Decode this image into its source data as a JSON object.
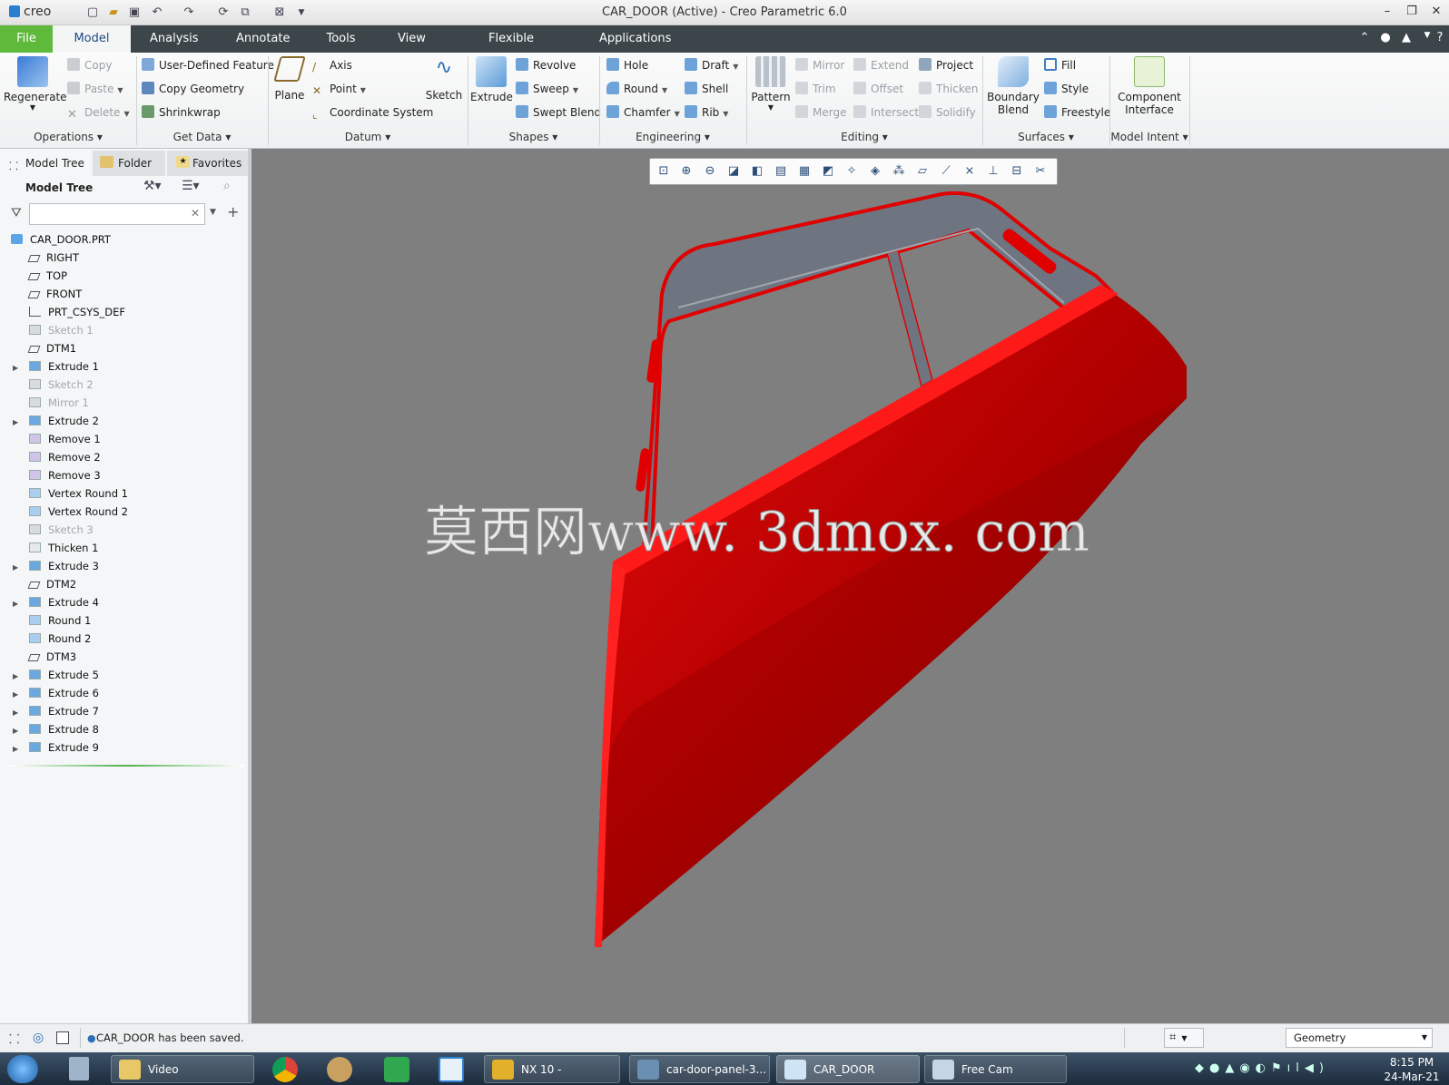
{
  "app": {
    "logo": "creo",
    "window_title": "CAR_DOOR (Active) - Creo Parametric 6.0"
  },
  "tabs": [
    "File",
    "Model",
    "Analysis",
    "Annotate",
    "Tools",
    "View",
    "Flexible Modeling",
    "Applications"
  ],
  "ribbon": {
    "operations": {
      "label": "Operations",
      "regenerate": "Regenerate",
      "copy": "Copy",
      "paste": "Paste",
      "delete": "Delete"
    },
    "get_data": {
      "label": "Get Data",
      "udf": "User-Defined Feature",
      "copy_geometry": "Copy Geometry",
      "shrinkwrap": "Shrinkwrap"
    },
    "datum": {
      "label": "Datum",
      "plane": "Plane",
      "axis": "Axis",
      "point": "Point",
      "csys": "Coordinate System",
      "sketch": "Sketch"
    },
    "shapes": {
      "label": "Shapes",
      "extrude": "Extrude",
      "revolve": "Revolve",
      "sweep": "Sweep",
      "swept_blend": "Swept Blend"
    },
    "engineering": {
      "label": "Engineering",
      "hole": "Hole",
      "round": "Round",
      "chamfer": "Chamfer",
      "draft": "Draft",
      "shell": "Shell",
      "rib": "Rib"
    },
    "editing": {
      "label": "Editing",
      "pattern": "Pattern",
      "mirror": "Mirror",
      "trim": "Trim",
      "merge": "Merge",
      "extend": "Extend",
      "offset": "Offset",
      "intersect": "Intersect",
      "project": "Project",
      "thicken": "Thicken",
      "solidify": "Solidify"
    },
    "surfaces": {
      "label": "Surfaces",
      "boundary_blend_1": "Boundary",
      "boundary_blend_2": "Blend",
      "fill": "Fill",
      "style": "Style",
      "freestyle": "Freestyle"
    },
    "model_intent": {
      "label": "Model Intent",
      "ci_1": "Component",
      "ci_2": "Interface"
    }
  },
  "panel": {
    "tabs": [
      "Model Tree",
      "Folder Br",
      "Favorites"
    ],
    "tree_header": "Model Tree",
    "filter_placeholder": "",
    "root": "CAR_DOOR.PRT",
    "items": [
      {
        "label": "RIGHT",
        "icon": "datum-plane-icon",
        "dim": false,
        "expand": false
      },
      {
        "label": "TOP",
        "icon": "datum-plane-icon",
        "dim": false,
        "expand": false
      },
      {
        "label": "FRONT",
        "icon": "datum-plane-icon",
        "dim": false,
        "expand": false
      },
      {
        "label": "PRT_CSYS_DEF",
        "icon": "csys-icon",
        "dim": false,
        "expand": false
      },
      {
        "label": "Sketch 1",
        "icon": "sketch-icon",
        "dim": true,
        "expand": false
      },
      {
        "label": "DTM1",
        "icon": "datum-plane-icon",
        "dim": false,
        "expand": false
      },
      {
        "label": "Extrude 1",
        "icon": "extrude-icon",
        "dim": false,
        "expand": true
      },
      {
        "label": "Sketch 2",
        "icon": "sketch-icon",
        "dim": true,
        "expand": false
      },
      {
        "label": "Mirror 1",
        "icon": "mirror-icon",
        "dim": true,
        "expand": false
      },
      {
        "label": "Extrude 2",
        "icon": "extrude-icon",
        "dim": false,
        "expand": true
      },
      {
        "label": "Remove 1",
        "icon": "remove-icon",
        "dim": false,
        "expand": false
      },
      {
        "label": "Remove 2",
        "icon": "remove-icon",
        "dim": false,
        "expand": false
      },
      {
        "label": "Remove 3",
        "icon": "remove-icon",
        "dim": false,
        "expand": false
      },
      {
        "label": "Vertex Round 1",
        "icon": "vertex-round-icon",
        "dim": false,
        "expand": false
      },
      {
        "label": "Vertex Round 2",
        "icon": "vertex-round-icon",
        "dim": false,
        "expand": false
      },
      {
        "label": "Sketch 3",
        "icon": "sketch-icon",
        "dim": true,
        "expand": false
      },
      {
        "label": "Thicken 1",
        "icon": "thicken-icon",
        "dim": false,
        "expand": false
      },
      {
        "label": "Extrude 3",
        "icon": "extrude-icon",
        "dim": false,
        "expand": true
      },
      {
        "label": "DTM2",
        "icon": "datum-plane-icon",
        "dim": false,
        "expand": false
      },
      {
        "label": "Extrude 4",
        "icon": "extrude-icon",
        "dim": false,
        "expand": true
      },
      {
        "label": "Round 1",
        "icon": "round-icon",
        "dim": false,
        "expand": false
      },
      {
        "label": "Round 2",
        "icon": "round-icon",
        "dim": false,
        "expand": false
      },
      {
        "label": "DTM3",
        "icon": "datum-plane-icon",
        "dim": false,
        "expand": false
      },
      {
        "label": "Extrude 5",
        "icon": "extrude-icon",
        "dim": false,
        "expand": true
      },
      {
        "label": "Extrude 6",
        "icon": "extrude-icon",
        "dim": false,
        "expand": true
      },
      {
        "label": "Extrude 7",
        "icon": "extrude-icon",
        "dim": false,
        "expand": true
      },
      {
        "label": "Extrude 8",
        "icon": "extrude-icon",
        "dim": false,
        "expand": true
      },
      {
        "label": "Extrude 9",
        "icon": "extrude-icon",
        "dim": false,
        "expand": true
      }
    ]
  },
  "viewport": {
    "watermark": "莫西网www. 3dmox. com",
    "background": "#7f7f7f",
    "part_color": "#e00000",
    "frame_color": "#6e7580"
  },
  "status": {
    "message": "CAR_DOOR has been saved.",
    "filter_value": "Geometry"
  },
  "taskbar": {
    "items": [
      "Video",
      "NX 10 -",
      "car-door-panel-3...",
      "CAR_DOOR (Activ...",
      "Free Cam"
    ],
    "time": "8:15 PM",
    "date": "24-Mar-21"
  }
}
